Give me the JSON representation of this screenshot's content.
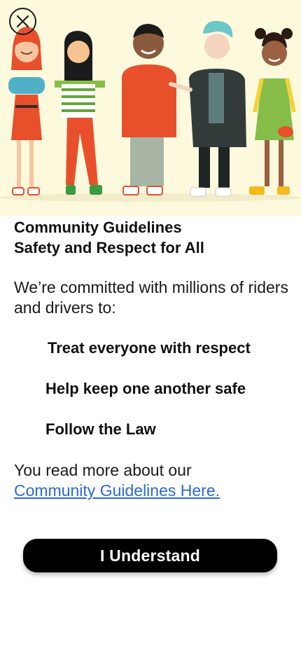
{
  "header": {
    "close_icon": "close-icon",
    "illustration": "group-of-diverse-people-illustration"
  },
  "guidelines": {
    "title_line1": "Community Guidelines",
    "title_line2": "Safety and Respect for All",
    "intro": "We’re committed with millions of riders and drivers to:",
    "principles": [
      "Treat everyone with respect",
      "Help keep one another safe",
      "Follow the Law"
    ],
    "more_text": "You read more about our",
    "more_link": "Community Guidelines Here."
  },
  "actions": {
    "understand_label": "I Understand"
  },
  "colors": {
    "hero_bg": "#fcf9dd",
    "link": "#2a6ad3",
    "button_bg": "#000000"
  }
}
